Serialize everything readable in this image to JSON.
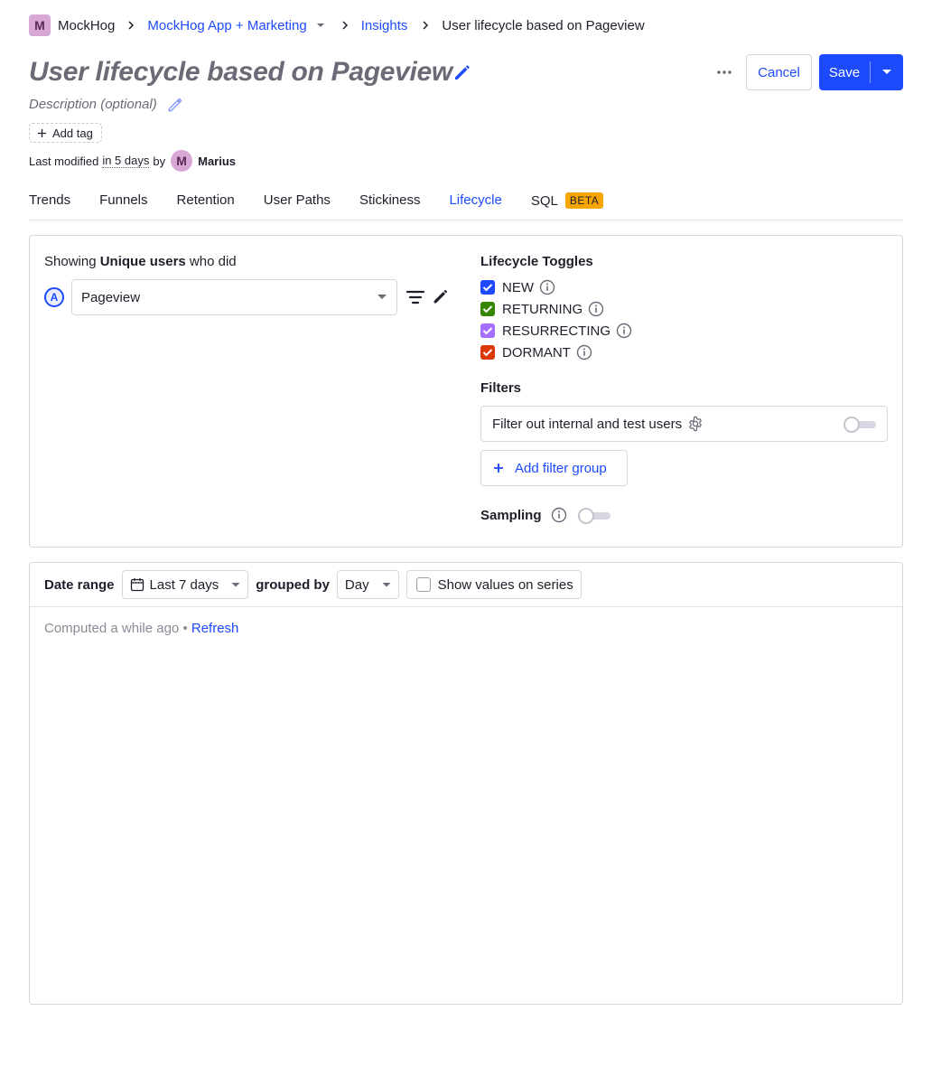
{
  "breadcrumb": {
    "org_initial": "M",
    "org_name": "MockHog",
    "project": "MockHog App + Marketing",
    "section": "Insights",
    "current": "User lifecycle based on Pageview"
  },
  "header": {
    "title": "User lifecycle based on Pageview",
    "description_placeholder": "Description (optional)",
    "add_tag_label": "Add tag",
    "cancel_label": "Cancel",
    "save_label": "Save",
    "last_modified_prefix": "Last modified",
    "last_modified_when": "in 5 days",
    "last_modified_by": "by",
    "user_initial": "M",
    "user_name": "Marius"
  },
  "tabs": [
    {
      "label": "Trends",
      "active": false
    },
    {
      "label": "Funnels",
      "active": false
    },
    {
      "label": "Retention",
      "active": false
    },
    {
      "label": "User Paths",
      "active": false
    },
    {
      "label": "Stickiness",
      "active": false
    },
    {
      "label": "Lifecycle",
      "active": true
    },
    {
      "label": "SQL",
      "active": false,
      "badge": "BETA"
    }
  ],
  "query": {
    "showing_prefix": "Showing",
    "showing_bold": "Unique users",
    "showing_suffix": "who did",
    "series_letter": "A",
    "event": "Pageview"
  },
  "lifecycle": {
    "title": "Lifecycle Toggles",
    "toggles": [
      {
        "label": "NEW",
        "color": "#1d4aff",
        "checked": true
      },
      {
        "label": "RETURNING",
        "color": "#388600",
        "checked": true
      },
      {
        "label": "RESURRECTING",
        "color": "#a56eff",
        "checked": true
      },
      {
        "label": "DORMANT",
        "color": "#db3707",
        "checked": true
      }
    ]
  },
  "filters": {
    "title": "Filters",
    "internal_label": "Filter out internal and test users",
    "internal_enabled": false,
    "add_group_label": "Add filter group"
  },
  "sampling": {
    "label": "Sampling",
    "enabled": false
  },
  "results": {
    "date_range_label": "Date range",
    "date_range_value": "Last 7 days",
    "grouped_by_label": "grouped by",
    "interval_value": "Day",
    "show_values_label": "Show values on series",
    "computed_text": "Computed a while ago",
    "bullet": "•",
    "refresh_label": "Refresh"
  },
  "colors": {
    "primary": "#1d4aff",
    "beta_badge": "#f7a501",
    "avatar": "#d9a7d6"
  }
}
